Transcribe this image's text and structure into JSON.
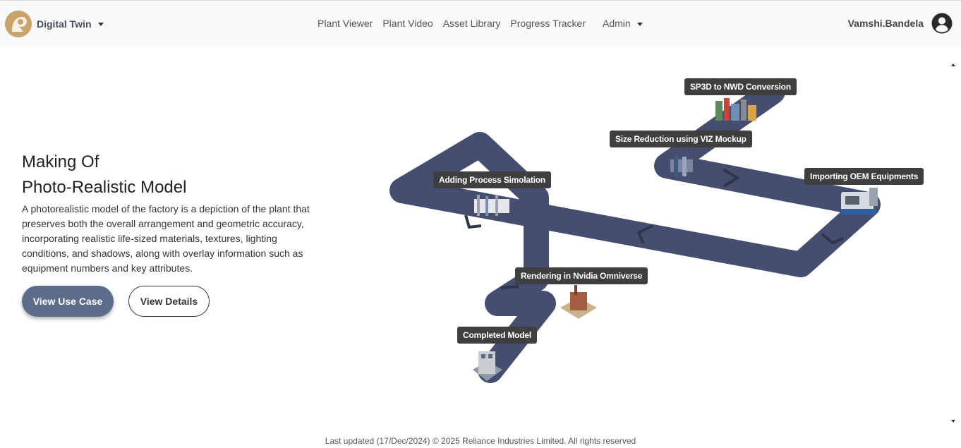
{
  "app": {
    "brand": "Digital Twin"
  },
  "nav": {
    "items": [
      "Plant Viewer",
      "Plant Video",
      "Asset Library",
      "Progress Tracker"
    ],
    "admin": "Admin"
  },
  "user": {
    "name": "Vamshi.Bandela",
    "avatar_icon": "user-circle-icon"
  },
  "hero": {
    "title_line1": "Making Of",
    "title_line2": "Photo-Realistic Model",
    "description": "A photorealistic model of the factory is a depiction of the plant that preserves both the overall arrangement and geometric accuracy, incorporating realistic life-sized materials, textures, lighting conditions, and shadows, along with overlay information such as equipment numbers and key attributes.",
    "primary_button": "View Use Case",
    "secondary_button": "View Details"
  },
  "process_steps": {
    "sp3d": "SP3D to NWD Conversion",
    "size_reduction": "Size Reduction using VIZ Mockup",
    "oem": "Importing OEM Equipments",
    "process_sim": "Adding Process Simolation",
    "rendering": "Rendering in Nvidia Omniverse",
    "completed": "Completed Model"
  },
  "colors": {
    "road": "#454e6e",
    "primary_button": "#5c6d8a",
    "label_bg": "#3f3f3f",
    "logo": "#c8a36a"
  },
  "footer": {
    "text": "Last updated (17/Dec/2024) © 2025 Reliance Industries Limited. All rights reserved"
  }
}
